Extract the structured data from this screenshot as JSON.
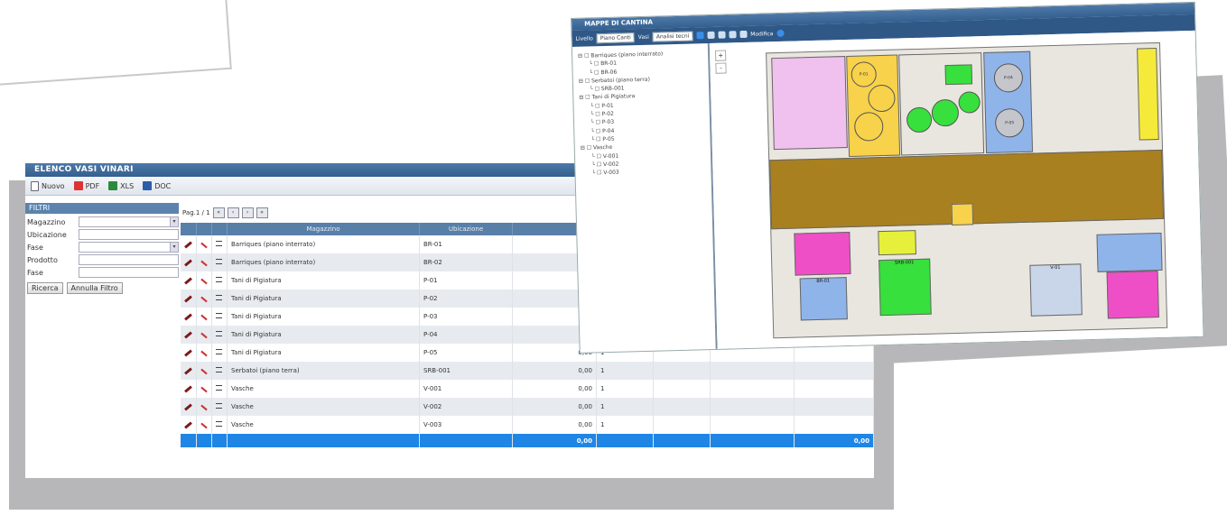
{
  "list_window": {
    "title": "ELENCO VASI VINARI",
    "toolbar": {
      "new": "Nuovo",
      "pdf": "PDF",
      "xls": "XLS",
      "doc": "DOC"
    },
    "filter": {
      "header": "FILTRI",
      "labels": {
        "magazzino": "Magazzino",
        "ubicazione": "Ubicazione",
        "fase": "Fase",
        "prodotto": "Prodotto",
        "fase2": "Fase"
      },
      "search_button": "Ricerca",
      "cancel_button": "Annulla Filtro"
    },
    "pager": {
      "text": "Pag.1 / 1"
    },
    "columns": {
      "magazzino": "Magazzino",
      "ubicazione": "Ubicazione"
    },
    "rows": [
      {
        "name": "Barriques (piano interrato)",
        "code": "BR-01",
        "value": "",
        "qty": ""
      },
      {
        "name": "Barriques (piano interrato)",
        "code": "BR-02",
        "value": "",
        "qty": ""
      },
      {
        "name": "Tani di Pigiatura",
        "code": "P-01",
        "value": "",
        "qty": ""
      },
      {
        "name": "Tani di Pigiatura",
        "code": "P-02",
        "value": "",
        "qty": ""
      },
      {
        "name": "Tani di Pigiatura",
        "code": "P-03",
        "value": "",
        "qty": ""
      },
      {
        "name": "Tani di Pigiatura",
        "code": "P-04",
        "value": "",
        "qty": ""
      },
      {
        "name": "Tani di Pigiatura",
        "code": "P-05",
        "value": "0,00",
        "qty": "1"
      },
      {
        "name": "Serbatoi (piano terra)",
        "code": "SRB-001",
        "value": "0,00",
        "qty": "1"
      },
      {
        "name": "Vasche",
        "code": "V-001",
        "value": "0,00",
        "qty": "1"
      },
      {
        "name": "Vasche",
        "code": "V-002",
        "value": "0,00",
        "qty": "1"
      },
      {
        "name": "Vasche",
        "code": "V-003",
        "value": "0,00",
        "qty": "1"
      }
    ],
    "total": {
      "value": "0,00",
      "right": "0,00"
    }
  },
  "map_window": {
    "title": "MAPPE DI CANTINA",
    "toolbar": {
      "livello_label": "Livello",
      "livello_value": "Piano Canti",
      "vasi_label": "Vasi",
      "vasi_value": "Analisi tecni",
      "modifica": "Modifica"
    },
    "tree": [
      {
        "label": "Barriques (piano interrato)",
        "level": 1
      },
      {
        "label": "BR-01",
        "level": 2
      },
      {
        "label": "BR-06",
        "level": 2
      },
      {
        "label": "Serbatoi (piano terra)",
        "level": 1
      },
      {
        "label": "SRB-001",
        "level": 2
      },
      {
        "label": "Tani di Pigiatura",
        "level": 1
      },
      {
        "label": "P-01",
        "level": 2
      },
      {
        "label": "P-02",
        "level": 2
      },
      {
        "label": "P-03",
        "level": 2
      },
      {
        "label": "P-04",
        "level": 2
      },
      {
        "label": "P-05",
        "level": 2
      },
      {
        "label": "Vasche",
        "level": 1
      },
      {
        "label": "V-001",
        "level": 2
      },
      {
        "label": "V-002",
        "level": 2
      },
      {
        "label": "V-003",
        "level": 2
      }
    ],
    "zoom": {
      "in": "+",
      "out": "-"
    },
    "plan_labels": {
      "p01": "P-01",
      "p04": "P-04",
      "p05": "P-05",
      "br01": "BR-01",
      "srb": "SRB-001",
      "v01": "V-01"
    },
    "colors": {
      "yellow": "#f7d24a",
      "blue": "#8fb4ea",
      "green": "#37e03c",
      "brown": "#a8801f",
      "pink": "#ef4fc6",
      "lime": "#e6f03b"
    }
  }
}
